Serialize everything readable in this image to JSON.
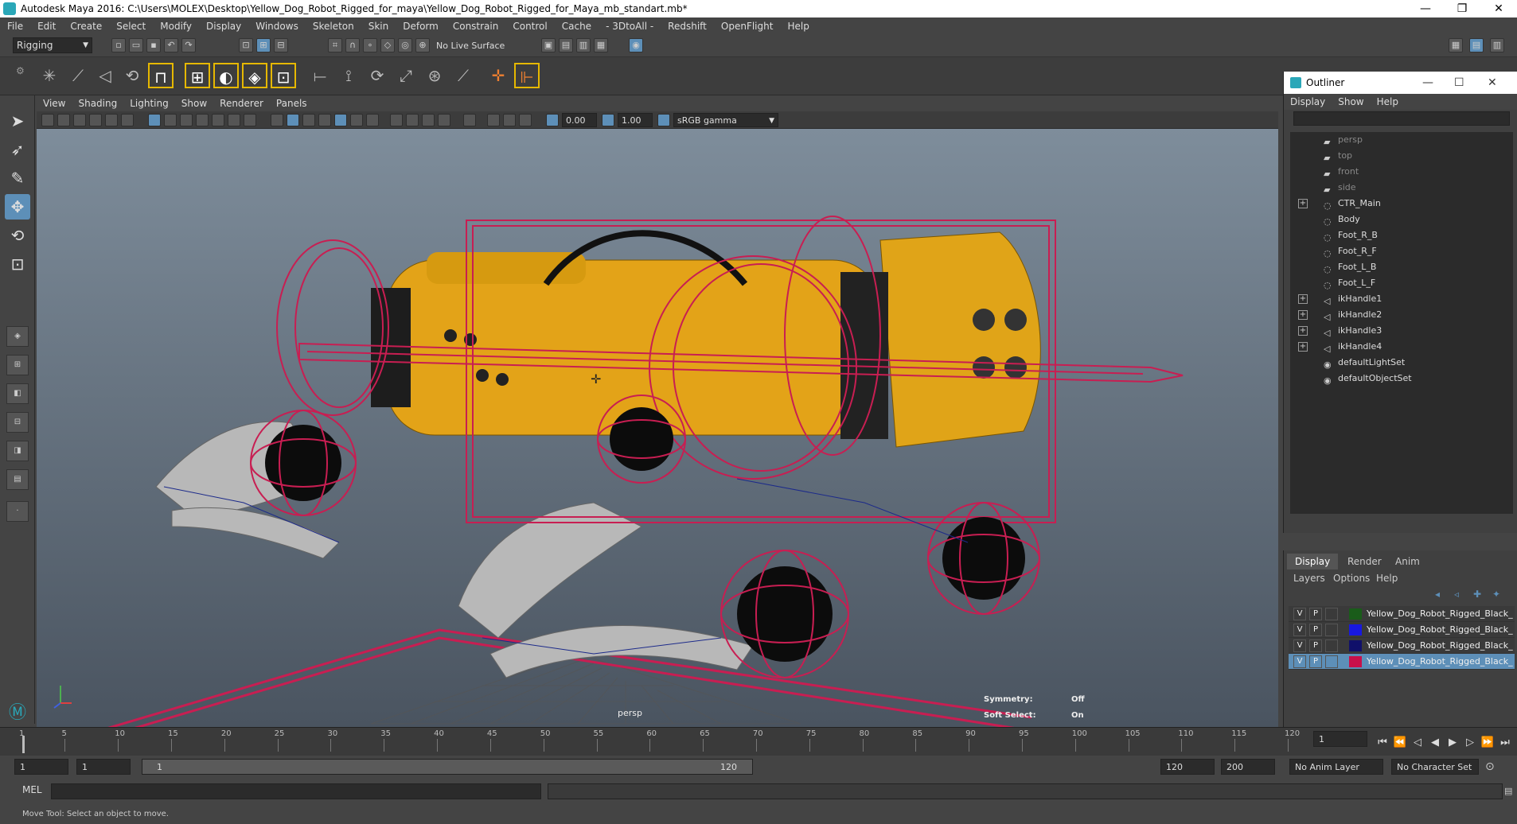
{
  "window": {
    "title": "Autodesk Maya 2016: C:\\Users\\MOLEX\\Desktop\\Yellow_Dog_Robot_Rigged_for_maya\\Yellow_Dog_Robot_Rigged_for_Maya_mb_standart.mb*",
    "minimize": "—",
    "restore": "❐",
    "close": "✕"
  },
  "menubar": [
    "File",
    "Edit",
    "Create",
    "Select",
    "Modify",
    "Display",
    "Windows",
    "Skeleton",
    "Skin",
    "Deform",
    "Constrain",
    "Control",
    "Cache",
    "- 3DtoAll -",
    "Redshift",
    "OpenFlight",
    "Help"
  ],
  "status_line": {
    "mode": "Rigging",
    "live_surface": "No Live Surface"
  },
  "viewport": {
    "menu": [
      "View",
      "Shading",
      "Lighting",
      "Show",
      "Renderer",
      "Panels"
    ],
    "exposure": "0.00",
    "gamma": "1.00",
    "color_space": "sRGB gamma",
    "camera_label": "persp",
    "symmetry_label": "Symmetry:",
    "symmetry_value": "Off",
    "soft_select_label": "Soft Select:",
    "soft_select_value": "On"
  },
  "outliner": {
    "title": "Outliner",
    "menu": [
      "Display",
      "Show",
      "Help"
    ],
    "items": [
      {
        "label": "persp",
        "dim": true,
        "expand": false,
        "icon": "camera-icon"
      },
      {
        "label": "top",
        "dim": true,
        "expand": false,
        "icon": "camera-icon"
      },
      {
        "label": "front",
        "dim": true,
        "expand": false,
        "icon": "camera-icon"
      },
      {
        "label": "side",
        "dim": true,
        "expand": false,
        "icon": "camera-icon"
      },
      {
        "label": "CTR_Main",
        "dim": false,
        "expand": true,
        "icon": "curve-icon"
      },
      {
        "label": "Body",
        "dim": false,
        "expand": false,
        "icon": "curve-icon"
      },
      {
        "label": "Foot_R_B",
        "dim": false,
        "expand": false,
        "icon": "curve-icon"
      },
      {
        "label": "Foot_R_F",
        "dim": false,
        "expand": false,
        "icon": "curve-icon"
      },
      {
        "label": "Foot_L_B",
        "dim": false,
        "expand": false,
        "icon": "curve-icon"
      },
      {
        "label": "Foot_L_F",
        "dim": false,
        "expand": false,
        "icon": "curve-icon"
      },
      {
        "label": "ikHandle1",
        "dim": false,
        "expand": true,
        "icon": "ik-handle-icon"
      },
      {
        "label": "ikHandle2",
        "dim": false,
        "expand": true,
        "icon": "ik-handle-icon"
      },
      {
        "label": "ikHandle3",
        "dim": false,
        "expand": true,
        "icon": "ik-handle-icon"
      },
      {
        "label": "ikHandle4",
        "dim": false,
        "expand": true,
        "icon": "ik-handle-icon"
      },
      {
        "label": "defaultLightSet",
        "dim": false,
        "expand": false,
        "icon": "set-icon"
      },
      {
        "label": "defaultObjectSet",
        "dim": false,
        "expand": false,
        "icon": "set-icon"
      }
    ]
  },
  "layer_editor": {
    "tabs": [
      "Display",
      "Render",
      "Anim"
    ],
    "menu": [
      "Layers",
      "Options",
      "Help"
    ],
    "rows": [
      {
        "v": "V",
        "p": "P",
        "color": "#1a5c1a",
        "name": "Yellow_Dog_Robot_Rigged_Black_R",
        "selected": false
      },
      {
        "v": "V",
        "p": "P",
        "color": "#1818e0",
        "name": "Yellow_Dog_Robot_Rigged_Black_R",
        "selected": false
      },
      {
        "v": "V",
        "p": "P",
        "color": "#10106a",
        "name": "Yellow_Dog_Robot_Rigged_Black_R",
        "selected": false
      },
      {
        "v": "V",
        "p": "P",
        "color": "#c8104a",
        "name": "Yellow_Dog_Robot_Rigged_Black_R",
        "selected": true
      }
    ]
  },
  "timeline": {
    "ticks": [
      "1",
      "5",
      "10",
      "15",
      "20",
      "25",
      "30",
      "35",
      "40",
      "45",
      "50",
      "55",
      "60",
      "65",
      "70",
      "75",
      "80",
      "85",
      "90",
      "95",
      "100",
      "105",
      "110",
      "115",
      "120"
    ],
    "current_frame": "1"
  },
  "range": {
    "start": "1",
    "playback_start": "1",
    "slider_start": "1",
    "slider_end": "120",
    "playback_end": "120",
    "end": "200",
    "anim_layer": "No Anim Layer",
    "character_set": "No Character Set"
  },
  "command_line": {
    "label": "MEL"
  },
  "help_line": "Move Tool: Select an object to move."
}
